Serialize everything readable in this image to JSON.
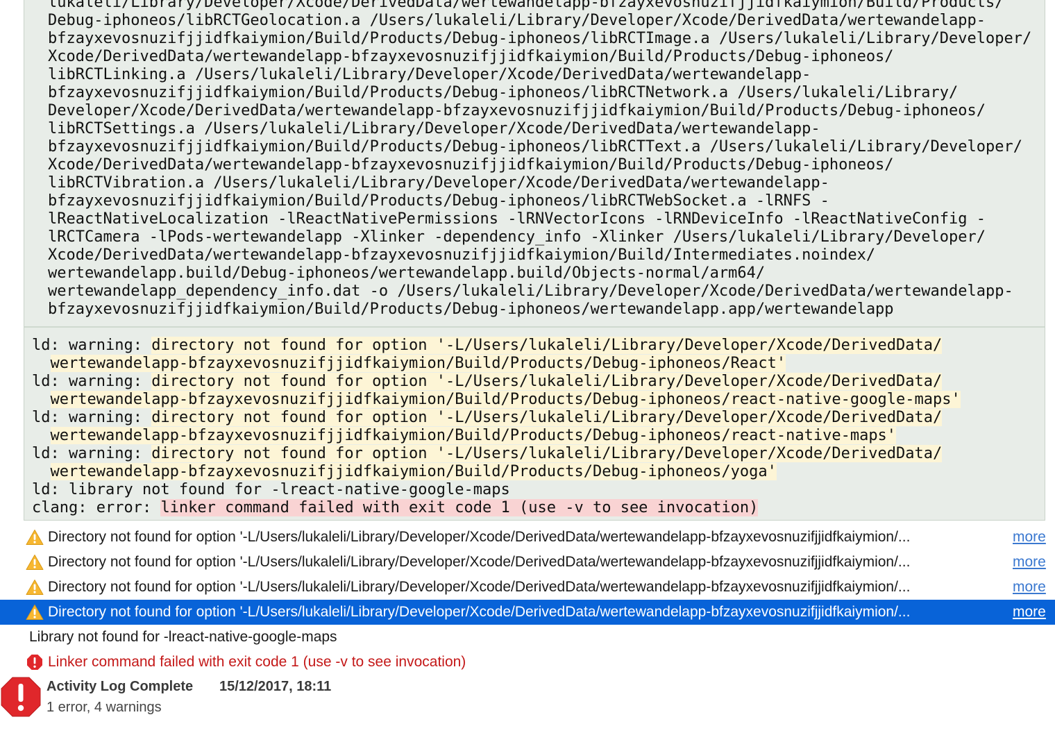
{
  "command_lines": [
    "lukaleli/Library/Developer/Xcode/DerivedData/wertewandelapp-bfzayxevosnuzifjjidfkaiymion/Build/Products/",
    "Debug-iphoneos/libRCTGeolocation.a /Users/lukaleli/Library/Developer/Xcode/DerivedData/wertewandelapp-",
    "bfzayxevosnuzifjjidfkaiymion/Build/Products/Debug-iphoneos/libRCTImage.a /Users/lukaleli/Library/Developer/",
    "Xcode/DerivedData/wertewandelapp-bfzayxevosnuzifjjidfkaiymion/Build/Products/Debug-iphoneos/",
    "libRCTLinking.a /Users/lukaleli/Library/Developer/Xcode/DerivedData/wertewandelapp-",
    "bfzayxevosnuzifjjidfkaiymion/Build/Products/Debug-iphoneos/libRCTNetwork.a /Users/lukaleli/Library/",
    "Developer/Xcode/DerivedData/wertewandelapp-bfzayxevosnuzifjjidfkaiymion/Build/Products/Debug-iphoneos/",
    "libRCTSettings.a /Users/lukaleli/Library/Developer/Xcode/DerivedData/wertewandelapp-",
    "bfzayxevosnuzifjjidfkaiymion/Build/Products/Debug-iphoneos/libRCTText.a /Users/lukaleli/Library/Developer/",
    "Xcode/DerivedData/wertewandelapp-bfzayxevosnuzifjjidfkaiymion/Build/Products/Debug-iphoneos/",
    "libRCTVibration.a /Users/lukaleli/Library/Developer/Xcode/DerivedData/wertewandelapp-",
    "bfzayxevosnuzifjjidfkaiymion/Build/Products/Debug-iphoneos/libRCTWebSocket.a -lRNFS -",
    "lReactNativeLocalization -lReactNativePermissions -lRNVectorIcons -lRNDeviceInfo -lReactNativeConfig -",
    "lRCTCamera -lPods-wertewandelapp -Xlinker -dependency_info -Xlinker /Users/lukaleli/Library/Developer/",
    "Xcode/DerivedData/wertewandelapp-bfzayxevosnuzifjjidfkaiymion/Build/Intermediates.noindex/",
    "wertewandelapp.build/Debug-iphoneos/wertewandelapp.build/Objects-normal/arm64/",
    "wertewandelapp_dependency_info.dat -o /Users/lukaleli/Library/Developer/Xcode/DerivedData/wertewandelapp-",
    "bfzayxevosnuzifjjidfkaiymion/Build/Products/Debug-iphoneos/wertewandelapp.app/wertewandelapp"
  ],
  "output": {
    "warnings": [
      {
        "prefix": "ld: warning: ",
        "line1": "directory not found for option '-L/Users/lukaleli/Library/Developer/Xcode/DerivedData/",
        "line2": "wertewandelapp-bfzayxevosnuzifjjidfkaiymion/Build/Products/Debug-iphoneos/React'"
      },
      {
        "prefix": "ld: warning: ",
        "line1": "directory not found for option '-L/Users/lukaleli/Library/Developer/Xcode/DerivedData/",
        "line2": "wertewandelapp-bfzayxevosnuzifjjidfkaiymion/Build/Products/Debug-iphoneos/react-native-google-maps'"
      },
      {
        "prefix": "ld: warning: ",
        "line1": "directory not found for option '-L/Users/lukaleli/Library/Developer/Xcode/DerivedData/",
        "line2": "wertewandelapp-bfzayxevosnuzifjjidfkaiymion/Build/Products/Debug-iphoneos/react-native-maps'"
      },
      {
        "prefix": "ld: warning: ",
        "line1": "directory not found for option '-L/Users/lukaleli/Library/Developer/Xcode/DerivedData/",
        "line2": "wertewandelapp-bfzayxevosnuzifjjidfkaiymion/Build/Products/Debug-iphoneos/yoga'"
      }
    ],
    "library_line": "ld: library not found for -lreact-native-google-maps",
    "clang_prefix": "clang: error: ",
    "clang_message": "linker command failed with exit code 1 (use -v to see invocation)"
  },
  "issues": [
    {
      "type": "warning",
      "text": "Directory not found for option '-L/Users/lukaleli/Library/Developer/Xcode/DerivedData/wertewandelapp-bfzayxevosnuzifjjidfkaiymion/...",
      "more": "more",
      "selected": false
    },
    {
      "type": "warning",
      "text": "Directory not found for option '-L/Users/lukaleli/Library/Developer/Xcode/DerivedData/wertewandelapp-bfzayxevosnuzifjjidfkaiymion/...",
      "more": "more",
      "selected": false
    },
    {
      "type": "warning",
      "text": "Directory not found for option '-L/Users/lukaleli/Library/Developer/Xcode/DerivedData/wertewandelapp-bfzayxevosnuzifjjidfkaiymion/...",
      "more": "more",
      "selected": false
    },
    {
      "type": "warning",
      "text": "Directory not found for option '-L/Users/lukaleli/Library/Developer/Xcode/DerivedData/wertewandelapp-bfzayxevosnuzifjjidfkaiymion/...",
      "more": "more",
      "selected": true
    },
    {
      "type": "plain",
      "text": "Library not found for -lreact-native-google-maps"
    },
    {
      "type": "error",
      "text": "Linker command failed with exit code 1 (use -v to see invocation)"
    }
  ],
  "footer": {
    "title": "Activity Log Complete",
    "timestamp": "15/12/2017, 18:11",
    "summary": "1 error, 4 warnings"
  },
  "icons": {
    "warning": "warning-triangle-icon",
    "error": "error-octagon-icon"
  },
  "colors": {
    "log_background": "#e8ede8",
    "warning_highlight": "#fdf5d6",
    "error_highlight": "#f9d3d3",
    "selection": "#0863d8",
    "error_text": "#c41818",
    "link": "#3a78d0"
  }
}
